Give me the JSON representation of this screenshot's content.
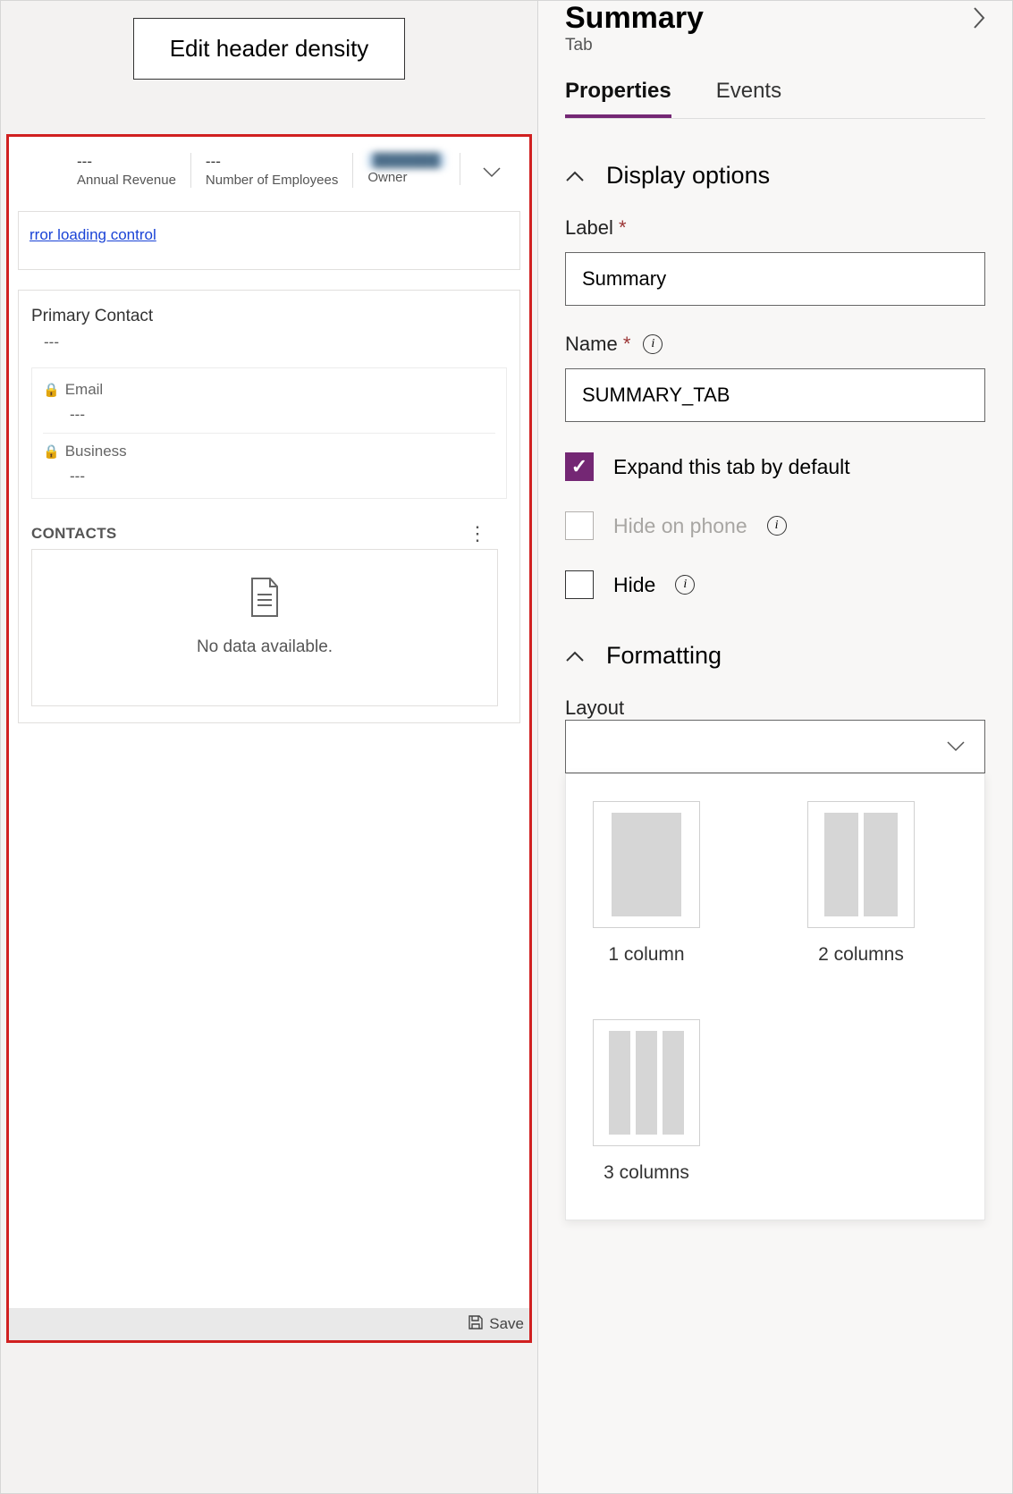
{
  "left": {
    "edit_header_btn": "Edit header density",
    "header_fields": {
      "annual_revenue": {
        "value": "---",
        "label": "Annual Revenue"
      },
      "num_employees": {
        "value": "---",
        "label": "Number of Employees"
      },
      "owner": {
        "value": "███████",
        "label": "Owner"
      }
    },
    "error_link": "rror loading control",
    "primary_contact": {
      "title": "Primary Contact",
      "value": "---"
    },
    "email": {
      "label": "Email",
      "value": "---"
    },
    "business": {
      "label": "Business",
      "value": "---"
    },
    "contacts_header": "CONTACTS",
    "no_data": "No data available.",
    "save": "Save"
  },
  "right": {
    "title": "Summary",
    "subtitle": "Tab",
    "tabs": {
      "properties": "Properties",
      "events": "Events"
    },
    "display_options": {
      "title": "Display options",
      "label_field": {
        "label": "Label",
        "value": "Summary"
      },
      "name_field": {
        "label": "Name",
        "value": "SUMMARY_TAB"
      },
      "expand_default": "Expand this tab by default",
      "hide_phone": "Hide on phone",
      "hide": "Hide"
    },
    "formatting": {
      "title": "Formatting",
      "layout_label": "Layout",
      "options": {
        "c1": "1 column",
        "c2": "2 columns",
        "c3": "3 columns"
      }
    }
  }
}
